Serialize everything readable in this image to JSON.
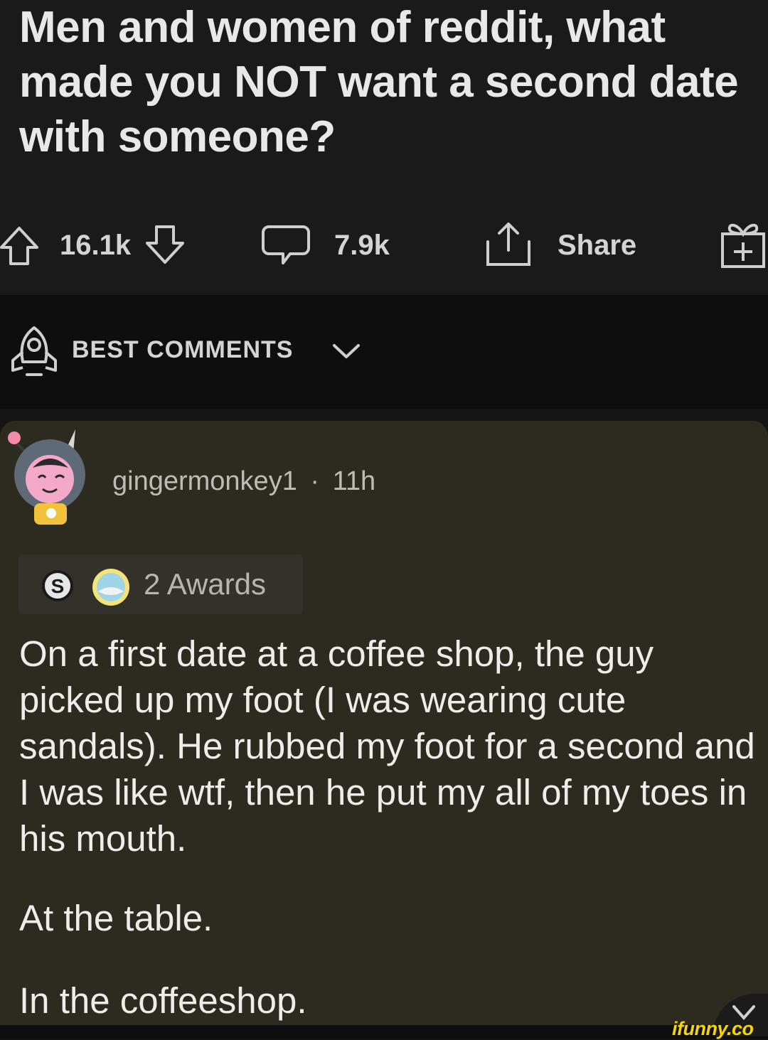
{
  "post": {
    "title": "Men and women of reddit, what made you NOT want a second date with someone?",
    "upvotes": "16.1k",
    "comments": "7.9k",
    "share_label": "Share"
  },
  "sort": {
    "label": "BEST COMMENTS"
  },
  "comment": {
    "username": "gingermonkey1",
    "separator": "·",
    "age": "11h",
    "awards": "2 Awards",
    "body": "On a first date at a coffee shop, the guy picked up my foot (I was wearing cute sandals). He rubbed my foot for a second and I was like wtf, then he put my all of my toes in his mouth.",
    "paragraph2": "At the table.",
    "paragraph3": "In the coffeeshop."
  },
  "watermark": "ifunny.co",
  "icons": [
    "upvote-icon",
    "downvote-icon",
    "comment-icon",
    "share-icon",
    "award-gift-icon",
    "rocket-icon",
    "chevron-down-icon",
    "avatar",
    "silver-award-icon",
    "wholesome-award-icon"
  ],
  "colors": {
    "post_bg": "#1a1a1b",
    "comment_bg": "#2d2a1f",
    "watermark": "#f4d40a"
  }
}
